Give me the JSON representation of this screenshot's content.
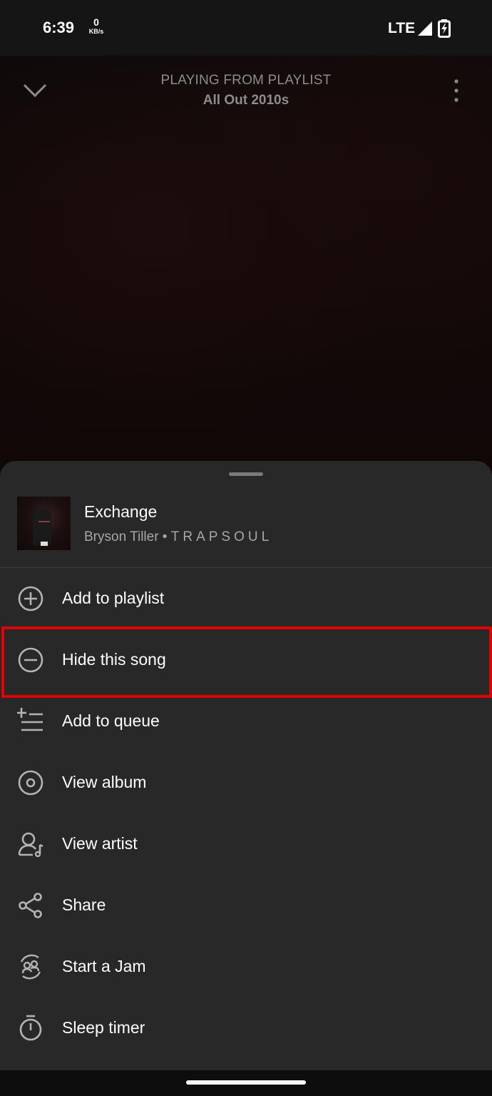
{
  "status_bar": {
    "time": "6:39",
    "net_speed_value": "0",
    "net_speed_unit": "KB/s",
    "network": "LTE"
  },
  "player": {
    "context_label": "PLAYING FROM PLAYLIST",
    "context_name": "All Out 2010s"
  },
  "sheet": {
    "track": {
      "title": "Exchange",
      "artist": "Bryson Tiller",
      "separator": " • ",
      "album": "TRAPSOUL"
    },
    "menu": [
      {
        "label": "Add to playlist",
        "icon": "add-circle-icon"
      },
      {
        "label": "Hide this song",
        "icon": "minus-circle-icon"
      },
      {
        "label": "Add to queue",
        "icon": "add-to-queue-icon"
      },
      {
        "label": "View album",
        "icon": "album-icon"
      },
      {
        "label": "View artist",
        "icon": "artist-icon"
      },
      {
        "label": "Share",
        "icon": "share-icon"
      },
      {
        "label": "Start a Jam",
        "icon": "jam-icon"
      },
      {
        "label": "Sleep timer",
        "icon": "timer-icon"
      }
    ],
    "highlight_color": "#e00000"
  }
}
